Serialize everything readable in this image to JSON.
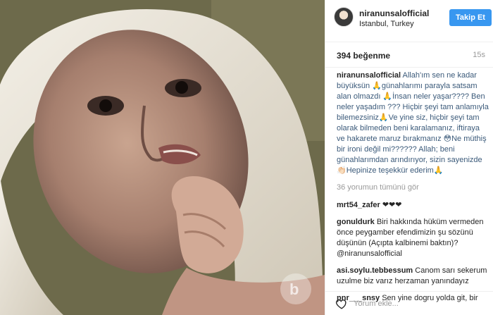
{
  "post": {
    "username": "niranunsalofficial",
    "location": "Istanbul, Turkey",
    "follow_label": "Takip Et",
    "likes": "394 beğenme",
    "time_ago": "15s"
  },
  "caption": {
    "username": "niranunsalofficial",
    "text": "Allah'ım sen ne kadar büyüksün 🙏günahlarımı parayla satsam alan olmazdı 🙏İnsan neler yaşar???? Ben neler yaşadım ??? Hiçbir şeyi tam anlamıyla bilemezsiniz🙏Ve yine siz, hiçbir şeyi tam olarak bilmeden beni karalamanız, iftiraya ve hakarete maruz bırakmanız 😳Ne müthiş bir ironi değil mi?????? Allah; beni günahlarımdan arındırıyor, sizin sayenizde 👏🏻Hepinize teşekkür ederim🙏"
  },
  "view_all_comments": "36 yorumun tümünü gör",
  "comments": [
    {
      "username": "mrt54_zafer",
      "text": "❤❤❤"
    },
    {
      "username": "gonuldurk",
      "text": "Biri hakkında hüküm vermeden önce peygamber efendimizin şu sözünü düşünün (Açıpta kalbinemi baktın)?@niranunsalofficial"
    },
    {
      "username": "asi.soylu.tebbessum",
      "text": "Canom sarı sekerum uzulme biz varız herzaman yanındayız"
    },
    {
      "username": "pnr___snsy",
      "text": "Sen yine dogru yolda git, bir"
    }
  ],
  "add_comment_placeholder": "Yorum ekle...",
  "icons": {
    "like": "heart-icon"
  }
}
